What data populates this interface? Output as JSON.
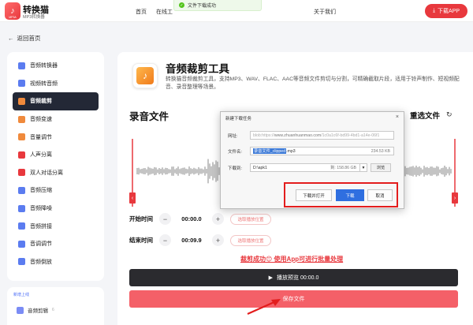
{
  "header": {
    "logo_glyph": "♪",
    "logo_tiny": "MP3A",
    "brand": "转换猫",
    "brand_sub": "MP3转换器",
    "nav": [
      "首页",
      "在线工",
      "关于我们"
    ],
    "download_app": "下载APP"
  },
  "toast": {
    "text": "文件下载成功"
  },
  "back_label": "返回首页",
  "sidebar": {
    "items": [
      {
        "label": "音频转换器",
        "color": "#5b7cf0"
      },
      {
        "label": "视频转音频",
        "color": "#5b7cf0"
      },
      {
        "label": "音频裁剪",
        "color": "#f08a3c",
        "active": true
      },
      {
        "label": "音频变速",
        "color": "#f08a3c"
      },
      {
        "label": "音量调节",
        "color": "#f08a3c"
      },
      {
        "label": "人声分离",
        "color": "#e8383d"
      },
      {
        "label": "双人对话分离",
        "color": "#e8383d"
      },
      {
        "label": "音频压缩",
        "color": "#5b7cf0"
      },
      {
        "label": "音频降噪",
        "color": "#5b7cf0"
      },
      {
        "label": "音频拼接",
        "color": "#5b7cf0"
      },
      {
        "label": "音调调节",
        "color": "#5b7cf0"
      },
      {
        "label": "音频倒放",
        "color": "#5b7cf0"
      }
    ],
    "foot_label": "新增上线",
    "foot_item": "音频剪辑",
    "foot_badge": "6"
  },
  "tool": {
    "title": "音频裁剪工具",
    "desc": "转换猫音频裁剪工具，支持MP3、WAV、FLAC、AAC等音频文件剪切与分割，可精确截取片段，适用于铃声制作、短视频配音、录音整理等场景。"
  },
  "recording": {
    "title": "录音文件",
    "reselect": "重选文件",
    "start_label": "开始时间",
    "start_value": "00:00.0",
    "end_label": "结束时间",
    "end_value": "00:09.9",
    "pick_pos": "选取播放位置",
    "success_text": "裁剪成功😊 使用App可进行批量处理",
    "preview": "播放预览 00:00.0",
    "save": "保存文件"
  },
  "dialog": {
    "title": "新建下载任务",
    "url_label": "网址:",
    "url_prefix": "blob:https://",
    "url_host": "www.zhuanhuanmao.com",
    "url_rest": "/1c0a1c6f-bd99-4bd1-a14e-06f1",
    "filename_label": "文件名:",
    "filename_selected": "录音文件_clipped",
    "filename_ext": ".mp3",
    "file_size": "234.53 KB",
    "saveto_label": "下载到:",
    "saveto_path": "D:\\apk1",
    "free_space": "剩: 158.86 GB",
    "browse": "浏览",
    "btn_open": "下载并打开",
    "btn_download": "下载",
    "btn_cancel": "取消",
    "close": "×"
  }
}
